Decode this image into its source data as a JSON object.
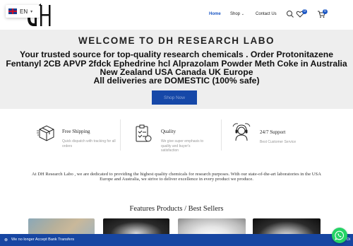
{
  "header": {
    "language": "EN",
    "nav": {
      "home": "Home",
      "shop": "Shop",
      "contact": "Contact Us"
    },
    "wishlist_count": "0",
    "cart_count": "0",
    "accent": "#1a56c4"
  },
  "hero": {
    "title": "WELCOME TO DH RESEARCH LABO",
    "subtitle": "Your trusted source for top-quality research chemicals . Order Protonitazene Fentanyl 2CB APVP 2fdck Ephedrine hcl Alprazolam Powder Meth Coke in Australia New Zealand USA Canada UK Europe",
    "domestic": "All deliveries are DOMESTIC (100% safe)",
    "button": "Shop Now"
  },
  "features": [
    {
      "icon": "box-icon",
      "title": "Free Shipping",
      "desc": "Quick dispatch with tracking for all orders"
    },
    {
      "icon": "quality-clipboard-icon",
      "title": "Quality",
      "desc": "We give super emphasis to quality and buyer's satisfaction"
    },
    {
      "icon": "support-agent-icon",
      "title": "24/7 Support",
      "desc": "Best Customer Service"
    }
  ],
  "about": "At DH Research Labo , we are dedicated to providing the highest quality chemicals for research purposes. With our state-of-the-art laboratories in the USA Europe and Australia, we strive to deliver excellence in every product we produce.",
  "products_title": "Features Products / Best Sellers",
  "notice": {
    "message": "We no longer Accept Bank Transfers",
    "dismiss": "Di"
  }
}
